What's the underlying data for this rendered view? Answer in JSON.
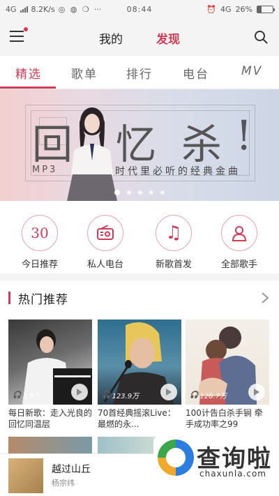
{
  "status_bar": {
    "network": "4G",
    "speed": "8.2K/s",
    "time": "08:44",
    "network_right": "4G",
    "battery": "26%",
    "battery_level": 0.26,
    "more": "···"
  },
  "header": {
    "tab_mine": "我的",
    "tab_discover": "发现",
    "active_tab": "发现",
    "menu_icon": "menu-icon",
    "search_icon": "search-icon"
  },
  "sub_tabs": {
    "items": [
      "精选",
      "歌单",
      "排行",
      "电台",
      "MV"
    ],
    "active_index": 0
  },
  "banner": {
    "title_chars": [
      "回",
      "忆",
      "杀",
      "!"
    ],
    "mp3": "MP3",
    "subtitle": "时代里必听的经典金曲",
    "page_count": 5,
    "active_dot": 0
  },
  "quick_entries": [
    {
      "label": "今日推荐",
      "icon": "calendar-30-icon",
      "icon_text": "30"
    },
    {
      "label": "私人电台",
      "icon": "radio-icon",
      "icon_text": ""
    },
    {
      "label": "新歌首发",
      "icon": "music-note-icon",
      "icon_text": "♫"
    },
    {
      "label": "全部歌手",
      "icon": "person-icon",
      "icon_text": ""
    }
  ],
  "section": {
    "title": "热门推荐"
  },
  "playlists": [
    {
      "count": "3.9万",
      "name": "每日新歌：走入光良的回忆同温层"
    },
    {
      "count": "123.9万",
      "name": "70首经典摇滚Live：最燃的永..."
    },
    {
      "count": "128.7万",
      "name": "100计告白杀手锏 牵手成功率之99"
    }
  ],
  "player": {
    "song": "越过山丘",
    "artist": "杨宗纬"
  },
  "watermark": {
    "brand": "查询啦",
    "domain": "chaxunla.com"
  },
  "colors": {
    "accent": "#d33a56",
    "background": "#f4f4f4"
  }
}
